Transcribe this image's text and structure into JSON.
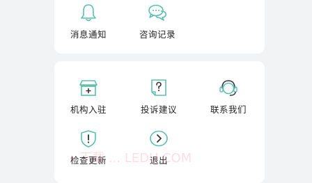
{
  "accent_color": "#5bbfae",
  "top_section": {
    "items": [
      {
        "label": "消息通知",
        "icon": "bell-icon"
      },
      {
        "label": "咨询记录",
        "icon": "chat-bubbles-icon"
      }
    ]
  },
  "bottom_section": {
    "items": [
      {
        "label": "机构入驻",
        "icon": "storefront-icon"
      },
      {
        "label": "投诉建议",
        "icon": "question-doc-icon"
      },
      {
        "label": "联系我们",
        "icon": "headset-icon"
      },
      {
        "label": "检查更新",
        "icon": "shield-alert-icon"
      },
      {
        "label": "退出",
        "icon": "exit-arrow-icon"
      }
    ]
  },
  "watermark": "- 下载 ... LEDU.COM"
}
